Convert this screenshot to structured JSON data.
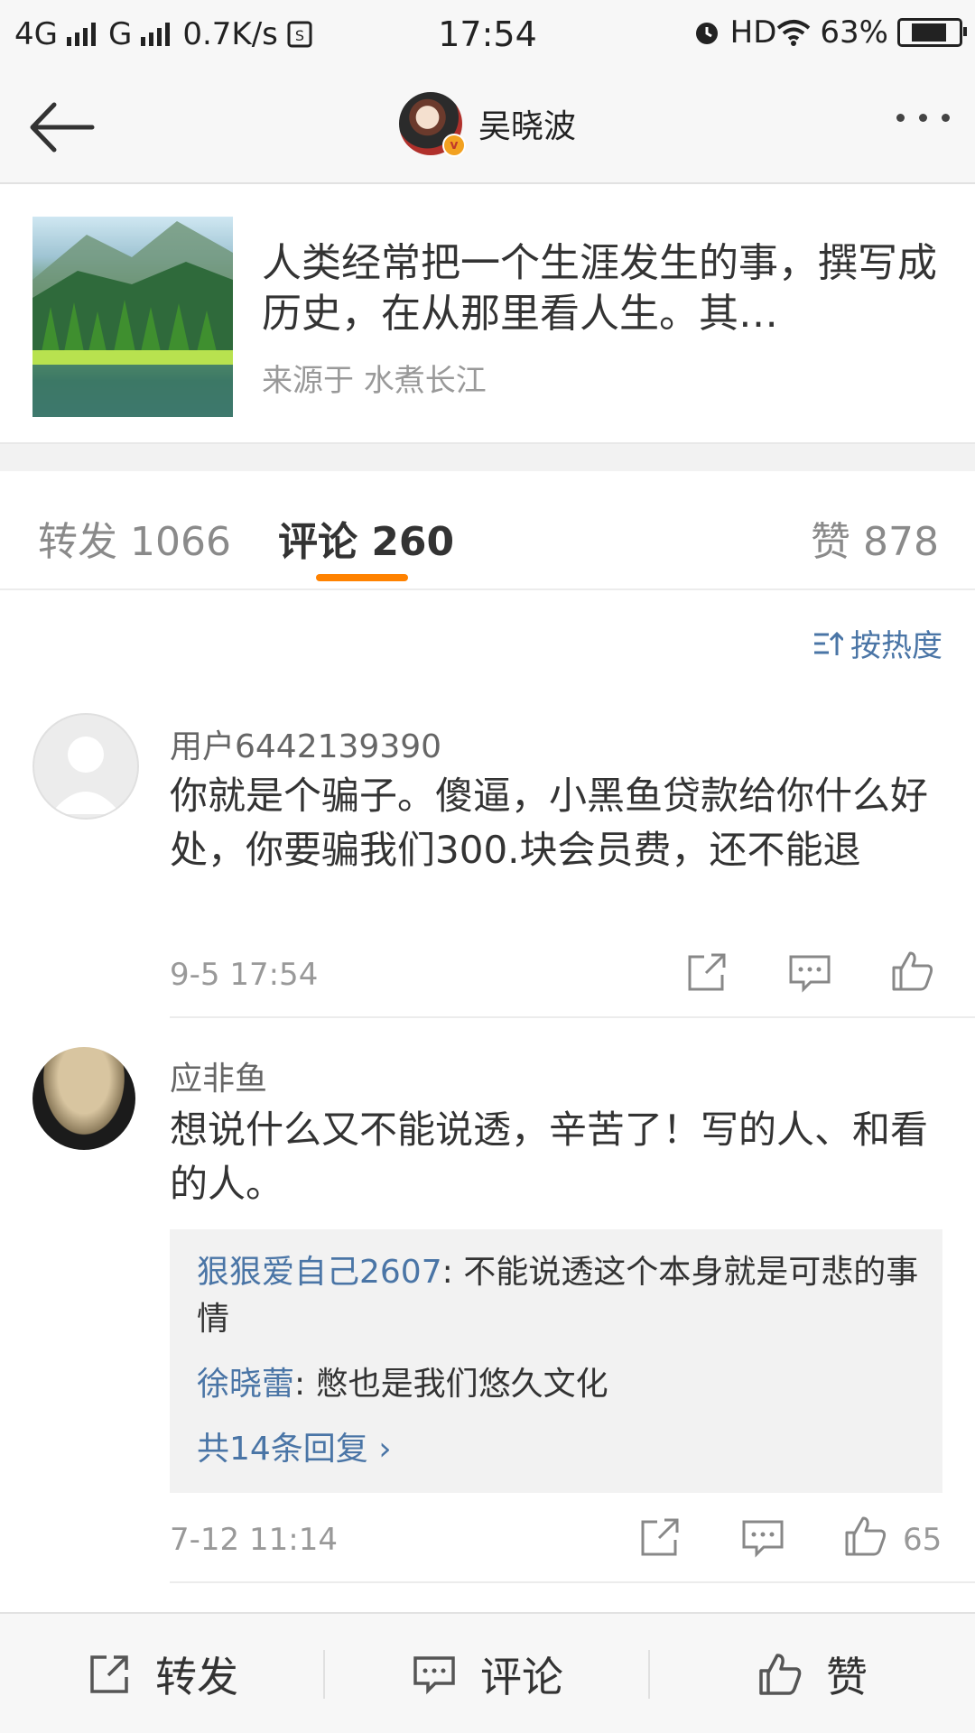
{
  "status_bar": {
    "network_left": "4G",
    "network_mid": "G",
    "speed": "0.7K/s",
    "time": "17:54",
    "hd": "HD",
    "battery": "63%"
  },
  "nav": {
    "title": "吴晓波"
  },
  "post": {
    "text": "人类经常把一个生涯发生的事，撰写成历史，在从那里看人生。其…",
    "source": "来源于 水煮长江"
  },
  "tabs": {
    "repost": "转发 1066",
    "comment": "评论 260",
    "like": "赞 878"
  },
  "sort": {
    "label": "按热度"
  },
  "comments": [
    {
      "user": "用户6442139390",
      "text": "你就是个骗子。傻逼，小黑鱼贷款给你什么好处，你要骗我们300.块会员费，还不能退",
      "time": "9-5 17:54",
      "likes": ""
    },
    {
      "user": "应非鱼",
      "text": "想说什么又不能说透，辛苦了！写的人、和看的人。",
      "time": "7-12 11:14",
      "likes": "65",
      "replies": [
        {
          "user": "狠狠爱自己2607",
          "text": ": 不能说透这个本身就是可悲的事情"
        },
        {
          "user": "徐晓蕾",
          "text": ": 憋也是我们悠久文化"
        }
      ],
      "more_replies": "共14条回复 ›"
    }
  ],
  "bottom_bar": {
    "repost": "转发",
    "comment": "评论",
    "like": "赞"
  },
  "colors": {
    "accent_orange": "#ff8200",
    "link_blue": "#4a75a6"
  }
}
